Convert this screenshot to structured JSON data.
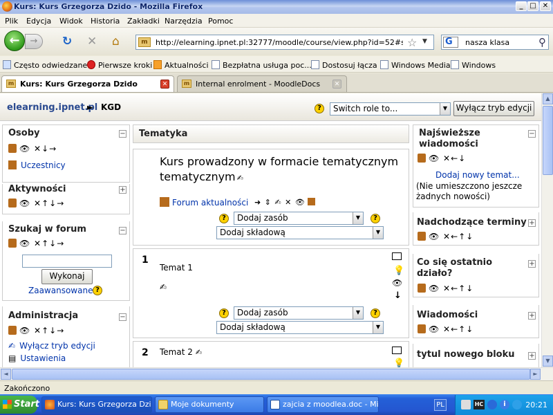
{
  "window": {
    "title": "Kurs: Kurs Grzegorza Dzido - Mozilla Firefox",
    "min": "_",
    "max": "□",
    "close": "✕"
  },
  "menu": [
    "Plik",
    "Edycja",
    "Widok",
    "Historia",
    "Zakładki",
    "Narzędzia",
    "Pomoc"
  ],
  "nav": {
    "back_icon": "←",
    "forward_icon": "→",
    "reload_icon": "↻",
    "stop_icon": "✕",
    "home_icon": "⌂",
    "url": "http://elearning.ipnet.pl:32777/moodle/course/view.php?id=52#section-0",
    "search_engine": "G",
    "search_value": "nasza klasa"
  },
  "bookmarks": [
    "Często odwiedzane",
    "Pierwsze kroki",
    "Aktualności",
    "Bezpłatna usługa poc...",
    "Dostosuj łącza",
    "Windows Media",
    "Windows"
  ],
  "tabs": [
    {
      "label": "Kurs: Kurs Grzegorza Dzido",
      "active": true
    },
    {
      "label": "Internal enrolment - MoodleDocs",
      "active": false
    }
  ],
  "header": {
    "site": "elearning.ipnet.pl",
    "separator": "►",
    "course": "KGD",
    "switch_role": "Switch role to...",
    "edit_button": "Wyłącz tryb edycji"
  },
  "left_blocks": [
    {
      "title": "Osoby",
      "controls": "👁 ✕↓→",
      "items": [
        {
          "label": "Uczestnicy"
        }
      ]
    },
    {
      "title": "Aktywności",
      "controls": "👁 ✕↑↓→"
    },
    {
      "title": "Szukaj w forum",
      "controls": "👁 ✕↑↓→",
      "search_button": "Wykonaj",
      "advanced": "Zaawansowane"
    },
    {
      "title": "Administracja",
      "controls": "👁 ✕↑↓→",
      "items": [
        {
          "label": "Wyłącz tryb edycji"
        },
        {
          "label": "Ustawienia"
        }
      ]
    }
  ],
  "main": {
    "title": "Tematyka",
    "section0": {
      "heading": "Kurs prowadzony w formacie tematycznym",
      "forum": "Forum aktualności",
      "forum_controls": "➜ ⇕ ✍ ✕ 👁",
      "add_resource": "Dodaj zasób",
      "add_activity": "Dodaj składową"
    },
    "sections": [
      {
        "num": "1",
        "title": "Temat 1",
        "add_resource": "Dodaj zasób",
        "add_activity": "Dodaj składową"
      },
      {
        "num": "2",
        "title": "Temat 2"
      }
    ]
  },
  "right_blocks": [
    {
      "title": "Najświeższe wiadomości",
      "controls": "👁 ✕←↓",
      "add_link": "Dodaj nowy temat...",
      "note": "(Nie umieszczono jeszcze żadnych nowości)"
    },
    {
      "title": "Nadchodzące terminy",
      "controls": "👁 ✕←↑↓"
    },
    {
      "title": "Co się ostatnio działo?",
      "controls": "👁 ✕←↑↓"
    },
    {
      "title": "Wiadomości",
      "controls": "👁 ✕←↑↓"
    },
    {
      "title": "tytul nowego bloku",
      "controls": ""
    }
  ],
  "status": "Zakończono",
  "taskbar": {
    "start": "Start",
    "tasks": [
      "Kurs: Kurs Grzegorza Dzi...",
      "Moje dokumenty",
      "zajcia z moodlea.doc - Mi..."
    ],
    "lang": "PL",
    "clock": "20:21"
  },
  "colors": {
    "link": "#0033aa",
    "taskbar": "#2456d0",
    "help": "#ffd200"
  }
}
